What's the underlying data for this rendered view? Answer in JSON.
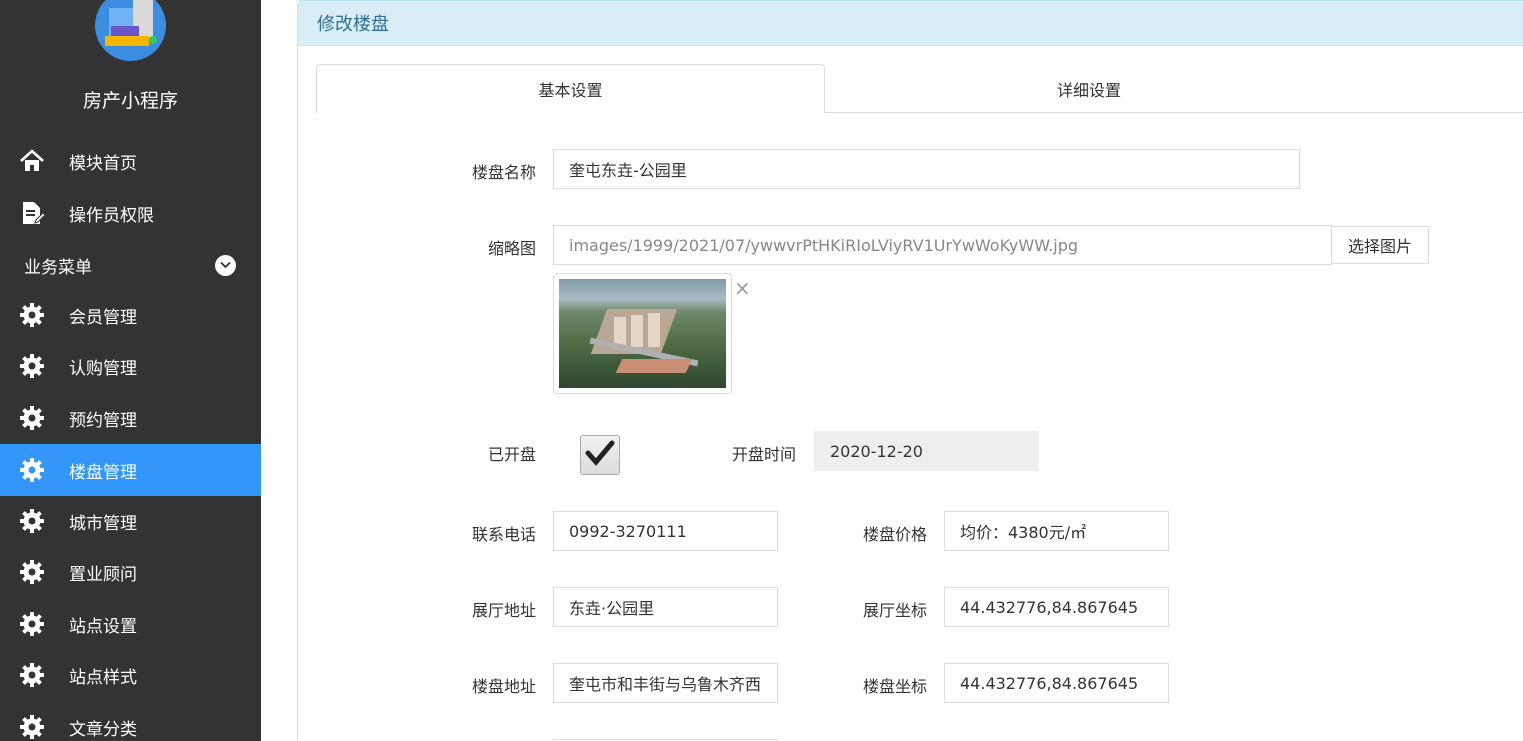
{
  "sidebar": {
    "app_title": "房产小程序",
    "items_top": [
      {
        "label": "模块首页",
        "icon": "home-icon"
      },
      {
        "label": "操作员权限",
        "icon": "document-edit-icon"
      }
    ],
    "section_label": "业务菜单",
    "items": [
      {
        "label": "会员管理",
        "icon": "gear-icon"
      },
      {
        "label": "认购管理",
        "icon": "gear-icon"
      },
      {
        "label": "预约管理",
        "icon": "gear-icon"
      },
      {
        "label": "楼盘管理",
        "icon": "gear-icon",
        "active": true
      },
      {
        "label": "城市管理",
        "icon": "gear-icon"
      },
      {
        "label": "置业顾问",
        "icon": "gear-icon"
      },
      {
        "label": "站点设置",
        "icon": "gear-icon"
      },
      {
        "label": "站点样式",
        "icon": "gear-icon"
      },
      {
        "label": "文章分类",
        "icon": "gear-icon"
      }
    ],
    "active_color": "#3296fa",
    "bg_color": "#333333"
  },
  "panel": {
    "title": "修改楼盘"
  },
  "tabs": [
    {
      "label": "基本设置",
      "active": true
    },
    {
      "label": "详细设置",
      "active": false
    }
  ],
  "form": {
    "name_label": "楼盘名称",
    "name_value": "奎屯东垚-公园里",
    "thumb_label": "缩略图",
    "thumb_value": "images/1999/2021/07/ywwvrPtHKiRIoLViyRV1UrYwWoKyWW.jpg",
    "thumb_button": "选择图片",
    "thumb_remove": "×",
    "opened_label": "已开盘",
    "opened_checked": true,
    "open_time_label": "开盘时间",
    "open_time_value": "2020-12-20",
    "phone_label": "联系电话",
    "phone_value": "0992-3270111",
    "price_label": "楼盘价格",
    "price_value": "均价：4380元/㎡",
    "hall_addr_label": "展厅地址",
    "hall_addr_value": "东垚·公园里",
    "hall_coord_label": "展厅坐标",
    "hall_coord_value": "44.432776,84.867645",
    "addr_label": "楼盘地址",
    "addr_value": "奎屯市和丰街与乌鲁木齐西",
    "coord_label": "楼盘坐标",
    "coord_value": "44.432776,84.867645"
  }
}
